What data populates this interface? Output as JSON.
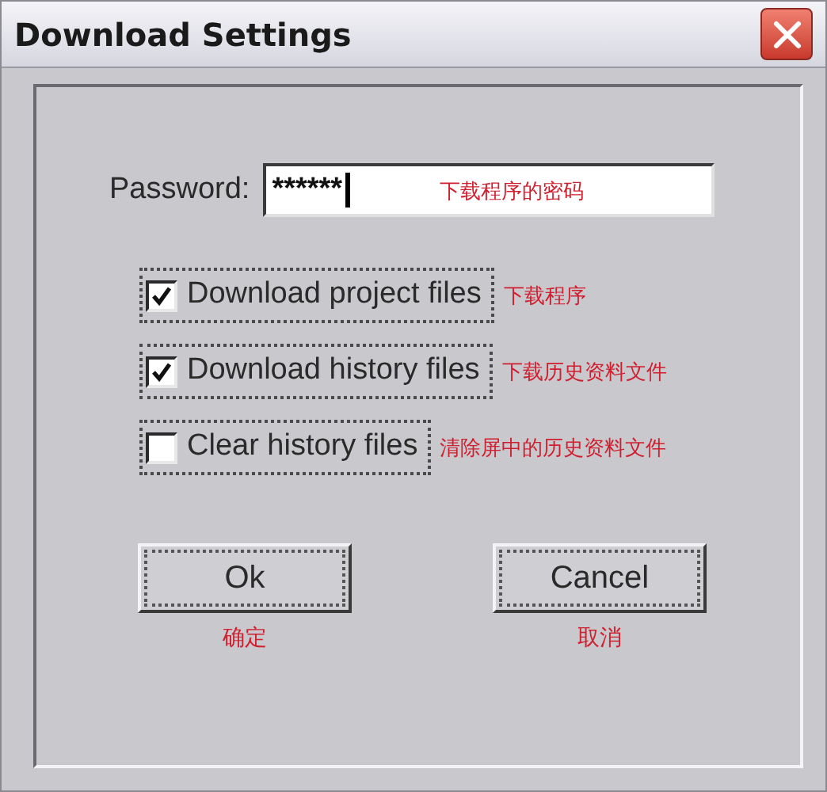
{
  "window": {
    "title": "Download Settings"
  },
  "password": {
    "label": "Password:",
    "value": "******",
    "focused": true,
    "annotation": "下载程序的密码"
  },
  "options": [
    {
      "label": "Download project files",
      "checked": true,
      "annotation": "下载程序"
    },
    {
      "label": "Download history files",
      "checked": true,
      "annotation": "下载历史资料文件"
    },
    {
      "label": "Clear history files",
      "checked": false,
      "annotation": "清除屏中的历史资料文件"
    }
  ],
  "buttons": [
    {
      "label": "Ok",
      "annotation": "确定"
    },
    {
      "label": "Cancel",
      "annotation": "取消"
    }
  ]
}
